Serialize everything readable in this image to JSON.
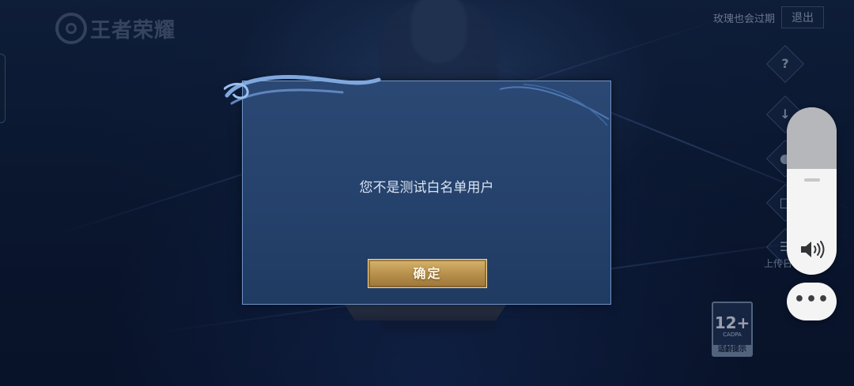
{
  "game": {
    "logo_text": "王者荣耀"
  },
  "account": {
    "name": "玫瑰也会过期",
    "logout_label": "退出"
  },
  "side_menu": {
    "help_icon_glyph": "?",
    "side_label": "上传日"
  },
  "age_rating": {
    "age": "12+",
    "org": "CADPA",
    "tip": "适龄提示"
  },
  "dialog": {
    "message": "您不是测试白名单用户",
    "confirm_label": "确定"
  },
  "volume": {
    "level": 0.63,
    "more_label": "•••"
  },
  "colors": {
    "dialog_bg": "#25426c",
    "dialog_border": "#6e93c7",
    "confirm_gold": "#c9a35a",
    "volume_fill": "#f4f4f5",
    "volume_empty": "#b5b7bb"
  },
  "icons": [
    "logo-icon",
    "help-icon",
    "download-icon",
    "sound-icon",
    "task-icon",
    "upload-log-icon",
    "speaker-icon"
  ]
}
